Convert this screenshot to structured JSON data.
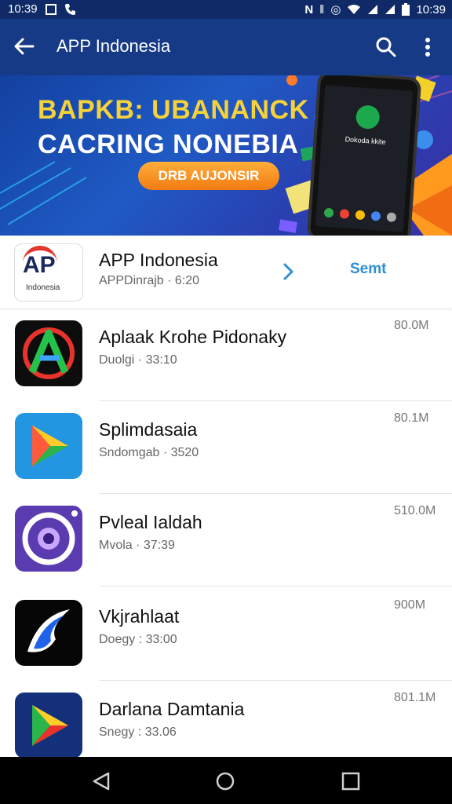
{
  "status_bar": {
    "left_time": "10:39",
    "right_time": "10:39",
    "icons": [
      "notification-icon",
      "phone-icon",
      "nfc-icon",
      "vibrate-icon",
      "alarm-icon",
      "wifi-icon",
      "signal-icon",
      "signal-icon",
      "battery-icon"
    ]
  },
  "app_bar": {
    "title": "APP Indonesia"
  },
  "banner": {
    "headline_line1_a": "BAPKB: ",
    "headline_line1_b": "UBANANCK",
    "headline_line2": "CACRING NONEBIA",
    "cta_label": "DRB AUJONSIR",
    "phone_text": "Dokoda kkite"
  },
  "featured": {
    "logo_text": "AP",
    "logo_caption": "Indonesia",
    "name": "APP Indonesia",
    "subtitle": "APPDinrajb · 6:20",
    "action_label": "Semt"
  },
  "apps": [
    {
      "name": "Aplaak Krohe Pidonaky",
      "subtitle": "Duolgi · 33:10",
      "size": "80.0M"
    },
    {
      "name": "Splimdasaia",
      "subtitle": "Sndomgab · 3520",
      "size": "80.1M"
    },
    {
      "name": "Pvleal Ialdah",
      "subtitle": "Mvola · 37:39",
      "size": "510.0M"
    },
    {
      "name": "Vkjrahlaat",
      "subtitle": "Doegy : 33:00",
      "size": "900M"
    },
    {
      "name": "Darlana Damtania",
      "subtitle": "Snegy : 33.06",
      "size": "801.1M"
    }
  ],
  "colors": {
    "app_bar": "#163a86",
    "status_bar": "#0f2a67",
    "accent": "#2e8fd6",
    "banner_yellow": "#f5d23a",
    "cta_orange": "#f27b12"
  }
}
